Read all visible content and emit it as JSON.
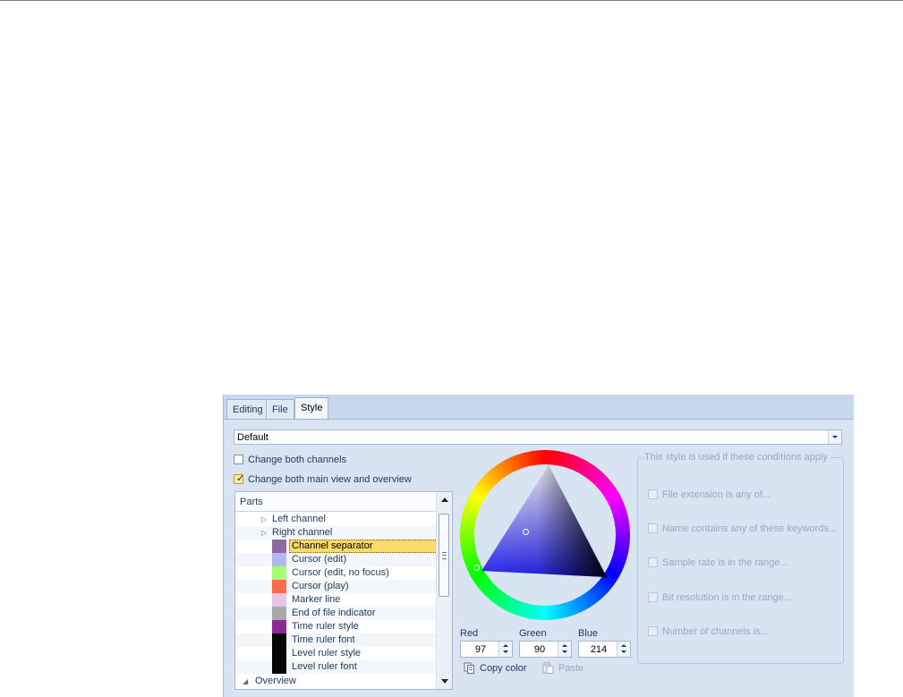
{
  "tabs": [
    {
      "label": "Editing",
      "active": false
    },
    {
      "label": "File",
      "active": false
    },
    {
      "label": "Style",
      "active": true
    }
  ],
  "style_dropdown": {
    "value": "Default"
  },
  "checkboxes": {
    "change_both_channels": {
      "label": "Change both channels",
      "checked": false
    },
    "change_both_views": {
      "label": "Change both main view and overview",
      "checked": true
    }
  },
  "parts": {
    "header": "Parts",
    "items": [
      {
        "label": "Left channel",
        "type": "group",
        "color": ""
      },
      {
        "label": "Right channel",
        "type": "group",
        "color": ""
      },
      {
        "label": "Channel separator",
        "type": "color",
        "color": "#8e6aa5",
        "selected": true
      },
      {
        "label": "Cursor (edit)",
        "type": "color",
        "color": "#b3b7ef"
      },
      {
        "label": "Cursor (edit, no focus)",
        "type": "color",
        "color": "#a4ff74"
      },
      {
        "label": "Cursor (play)",
        "type": "color",
        "color": "#ff6b4c"
      },
      {
        "label": "Marker line",
        "type": "color",
        "color": "#e5c5e9"
      },
      {
        "label": "End of file indicator",
        "type": "color",
        "color": "#a8a8a8"
      },
      {
        "label": "Time ruler style",
        "type": "color",
        "color": "#8a2a93"
      },
      {
        "label": "Time ruler font",
        "type": "color",
        "color": "#050505"
      },
      {
        "label": "Level ruler style",
        "type": "color",
        "color": "#050505"
      },
      {
        "label": "Level ruler font",
        "type": "color",
        "color": "#050505"
      },
      {
        "label": "Overview",
        "type": "root",
        "color": ""
      }
    ]
  },
  "color": {
    "red_label": "Red",
    "red": "97",
    "green_label": "Green",
    "green": "90",
    "blue_label": "Blue",
    "blue": "214",
    "hex": "#615ad6"
  },
  "actions": {
    "copy_color": "Copy color",
    "paste": "Paste"
  },
  "conditions": {
    "title": "This style is used if these conditions apply",
    "items": [
      "File extension is any of...",
      "Name contains any of these keywords...",
      "Sample rate is in the range...",
      "Bit resolution is in the range...",
      "Number of channels is..."
    ]
  },
  "icons": {
    "dropdown": "chevron-down-icon",
    "copy": "copy-icon",
    "paste": "paste-icon",
    "expand": "expand-arrow-icon"
  }
}
